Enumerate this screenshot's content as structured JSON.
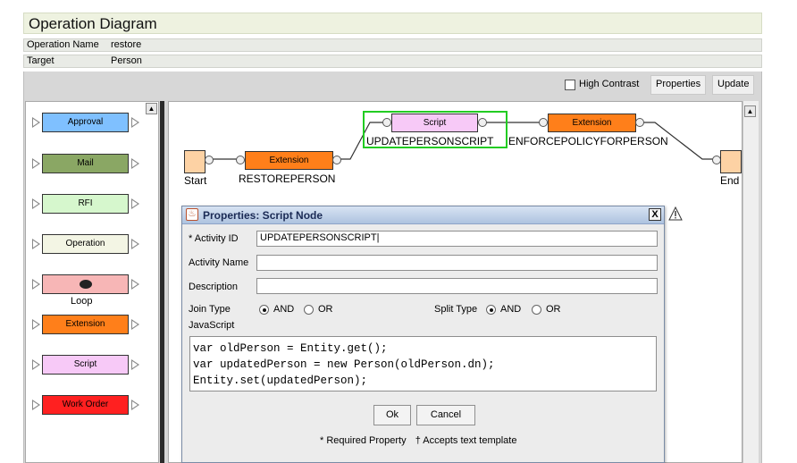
{
  "header": {
    "title": "Operation Diagram",
    "operation_name_label": "Operation Name",
    "operation_name_value": "restore",
    "target_label": "Target",
    "target_value": "Person"
  },
  "toolbar": {
    "high_contrast_label": "High Contrast",
    "high_contrast_checked": false,
    "properties_label": "Properties",
    "update_label": "Update"
  },
  "palette": {
    "items": [
      {
        "label": "Approval",
        "color": "#7fc0ff"
      },
      {
        "label": "Mail",
        "color": "#8aa764"
      },
      {
        "label": "RFI",
        "color": "#d6f7cd"
      },
      {
        "label": "Operation",
        "color": "#f3f5e4"
      },
      {
        "label": "Loop",
        "color": "#f7b6b6"
      },
      {
        "label": "Extension",
        "color": "#ff7f1a"
      },
      {
        "label": "Script",
        "color": "#f7c9f7"
      },
      {
        "label": "Work Order",
        "color": "#ff2020"
      }
    ]
  },
  "diagram": {
    "start_label": "Start",
    "end_label": "End",
    "node1_type": "Extension",
    "node1_name": "RESTOREPERSON",
    "node2_type": "Script",
    "node2_name": "UPDATEPERSONSCRIPT",
    "node3_type": "Extension",
    "node3_name": "ENFORCEPOLICYFORPERSON",
    "selection_color": "#22cc22"
  },
  "dialog": {
    "title": "Properties: Script Node",
    "close_glyph": "X",
    "activity_id_label": "* Activity ID",
    "activity_id_value": "UPDATEPERSONSCRIPT",
    "activity_name_label": "Activity Name",
    "activity_name_value": "",
    "description_label": "Description",
    "description_value": "",
    "join_type_label": "Join Type",
    "join_and_label": "AND",
    "join_or_label": "OR",
    "join_selected": "AND",
    "split_type_label": "Split Type",
    "split_and_label": "AND",
    "split_or_label": "OR",
    "split_selected": "AND",
    "javascript_label": "JavaScript",
    "code_lines": [
      "var oldPerson = Entity.get();",
      "var updatedPerson = new Person(oldPerson.dn);",
      "Entity.set(updatedPerson);"
    ],
    "ok_label": "Ok",
    "cancel_label": "Cancel",
    "required_note": "* Required Property",
    "template_note": "† Accepts text template"
  }
}
